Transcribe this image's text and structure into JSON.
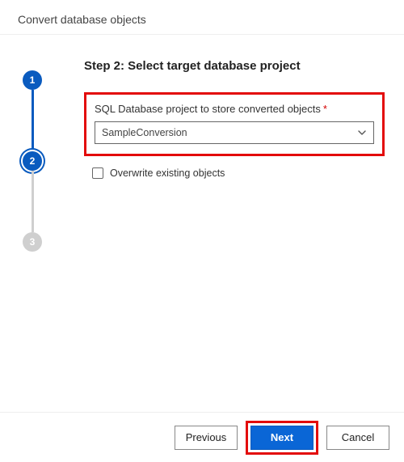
{
  "dialog": {
    "title": "Convert database objects"
  },
  "stepper": {
    "step1": "1",
    "step2": "2",
    "step3": "3"
  },
  "content": {
    "heading": "Step 2: Select target database project",
    "field_label": "SQL Database project to store converted objects",
    "required_mark": "*",
    "select_value": "SampleConversion",
    "overwrite_label": "Overwrite existing objects"
  },
  "footer": {
    "previous": "Previous",
    "next": "Next",
    "cancel": "Cancel"
  }
}
